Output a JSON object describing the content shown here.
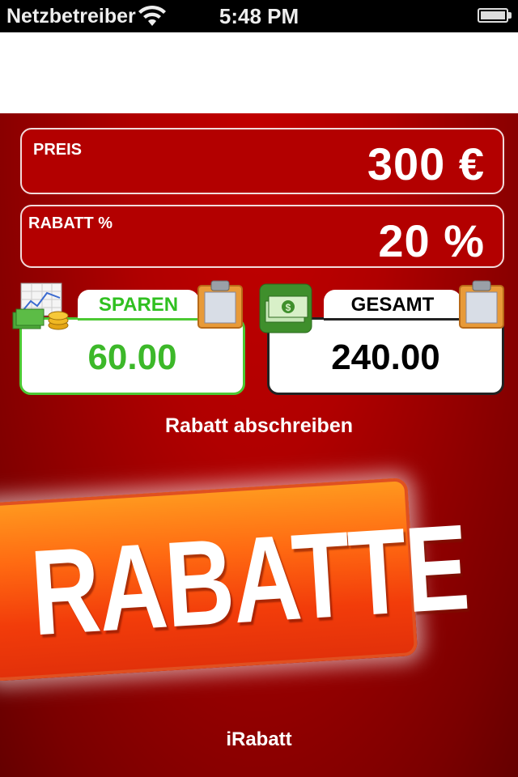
{
  "status_bar": {
    "carrier": "Netzbetreiber",
    "time": "5:48 PM",
    "icons": [
      "wifi-icon",
      "battery-icon"
    ]
  },
  "form": {
    "price": {
      "label": "PREIS",
      "value": "300 €"
    },
    "discount": {
      "label": "RABATT %",
      "value": "20 %"
    }
  },
  "results": {
    "savings": {
      "label": "SPAREN",
      "value": "60.00",
      "icon": "chart-coins-icon"
    },
    "total": {
      "label": "GESAMT",
      "value": "240.00",
      "icon": "money-stack-icon"
    }
  },
  "actions": {
    "write_off": "Rabatt abschreiben",
    "main_button": "RABATTE"
  },
  "footer": {
    "app_name": "iRabatt"
  },
  "colors": {
    "background_red": "#b00000",
    "save_green": "#3cb829",
    "button_orange": "#ff7a18"
  }
}
